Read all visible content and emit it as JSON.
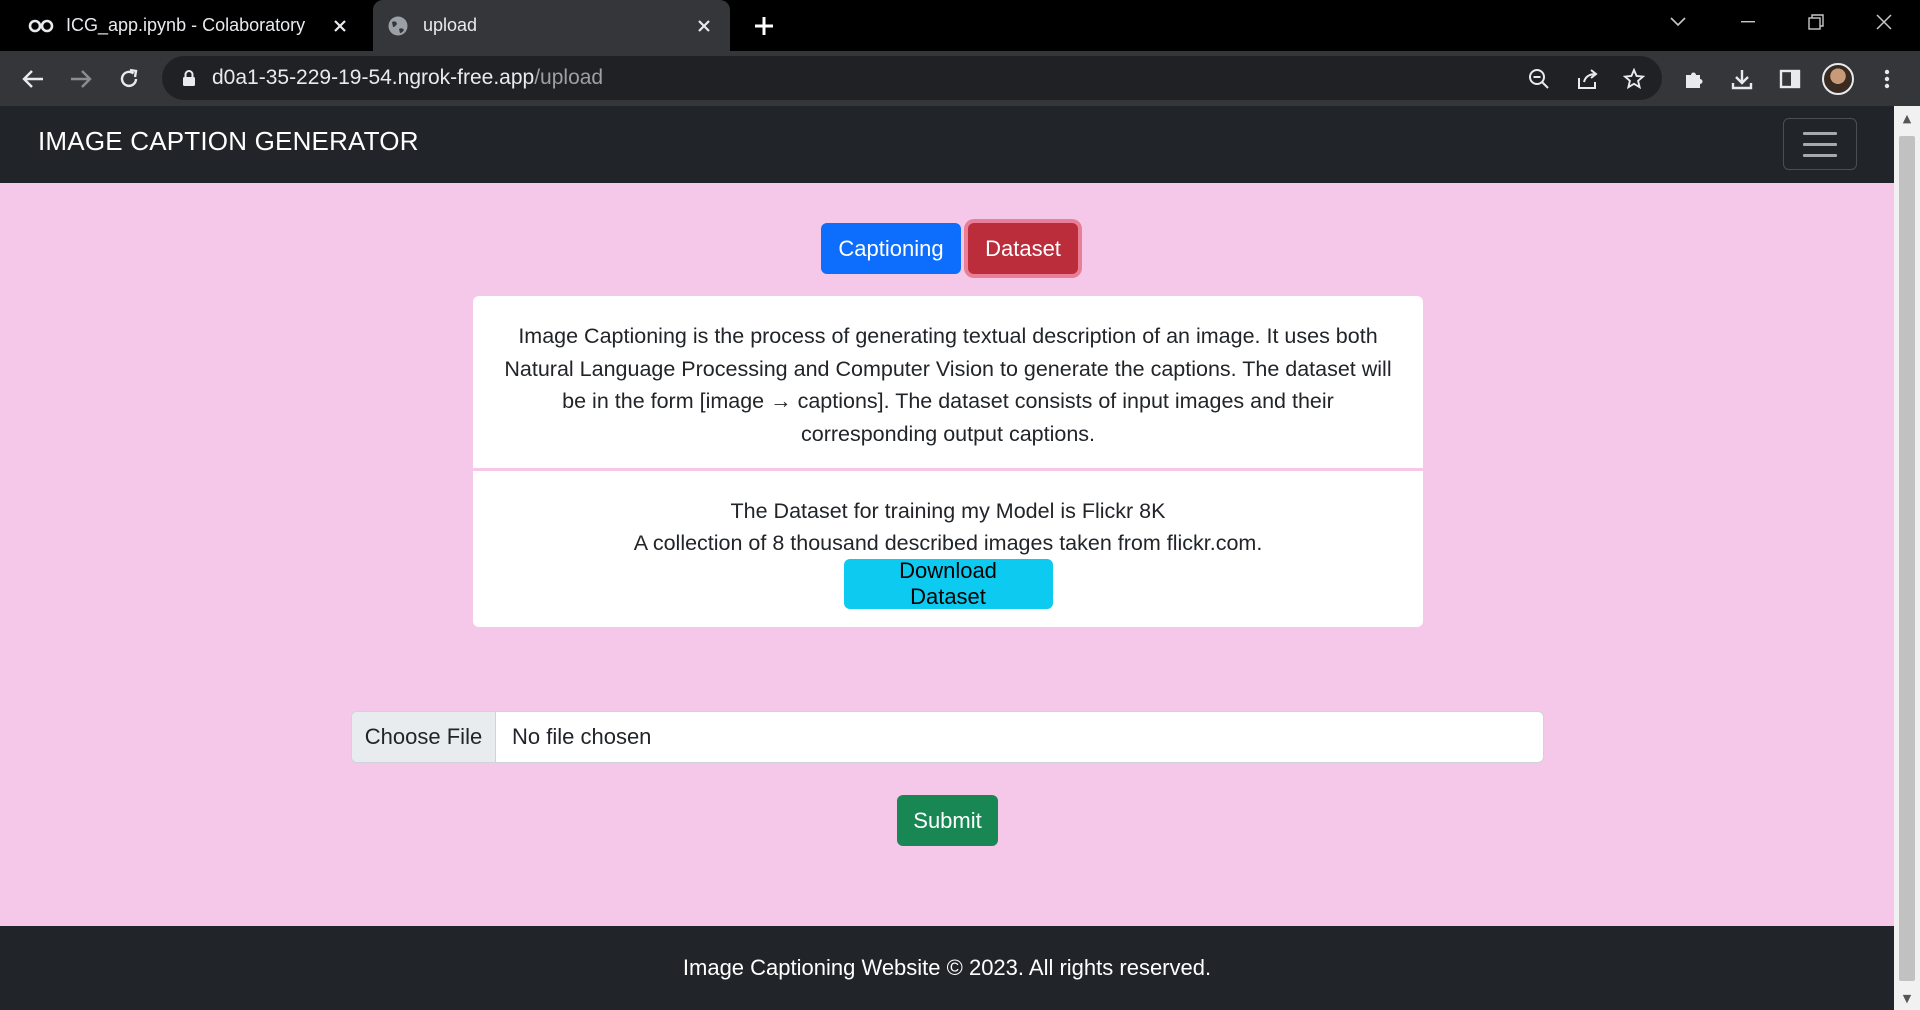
{
  "browser": {
    "tabs": [
      {
        "title": "ICG_app.ipynb - Colaboratory",
        "favicon": "colab-icon",
        "active": false
      },
      {
        "title": "upload",
        "favicon": "globe-icon",
        "active": true
      }
    ],
    "address": {
      "host": "d0a1-35-229-19-54.ngrok-free.app",
      "path": "/upload"
    }
  },
  "site": {
    "brand": "IMAGE CAPTION GENERATOR",
    "buttons": {
      "captioning": "Captioning",
      "dataset": "Dataset"
    },
    "description": "Image Captioning is the process of generating textual description of an image. It uses both Natural Language Processing and Computer Vision to generate the captions. The dataset will be in the form [image → captions]. The dataset consists of input images and their corresponding output captions.",
    "dataset_card": {
      "line1": "The Dataset for training my Model is Flickr 8K",
      "line2": "A collection of 8 thousand described images taken from flickr.com.",
      "download_label": "Download Dataset"
    },
    "file_input": {
      "button": "Choose File",
      "status": "No file chosen"
    },
    "submit_label": "Submit",
    "footer": "Image Captioning Website © 2023. All rights reserved."
  },
  "colors": {
    "page_bg": "#f5c8e9",
    "nav_bg": "#212529",
    "primary": "#0d6efd",
    "danger": "#bb2d3b",
    "info": "#0dcaf0",
    "success": "#198754"
  }
}
